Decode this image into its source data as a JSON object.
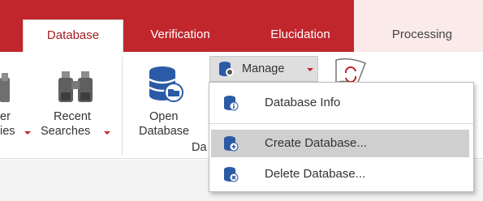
{
  "tabs": [
    {
      "label": "Database",
      "active": true
    },
    {
      "label": "Verification",
      "active": false
    },
    {
      "label": "Elucidation",
      "active": false
    },
    {
      "label": "Processing",
      "active": false
    }
  ],
  "ribbon": {
    "partial_left_top": "er",
    "partial_left_bottom": "ies",
    "recent": {
      "line1": "Recent",
      "line2": "Searches"
    },
    "open": {
      "line1": "Open",
      "line2": "Database"
    },
    "group_label_partial": "Da",
    "manage_label": "Manage"
  },
  "menu": {
    "items": [
      {
        "label": "Database Info",
        "icon": "database-info-icon"
      },
      {
        "label": "Create Database...",
        "icon": "create-database-icon",
        "highlighted": true
      },
      {
        "label": "Delete Database...",
        "icon": "delete-database-icon"
      }
    ]
  },
  "colors": {
    "accent": "#c2262d",
    "icon_blue": "#2b5aa6"
  }
}
